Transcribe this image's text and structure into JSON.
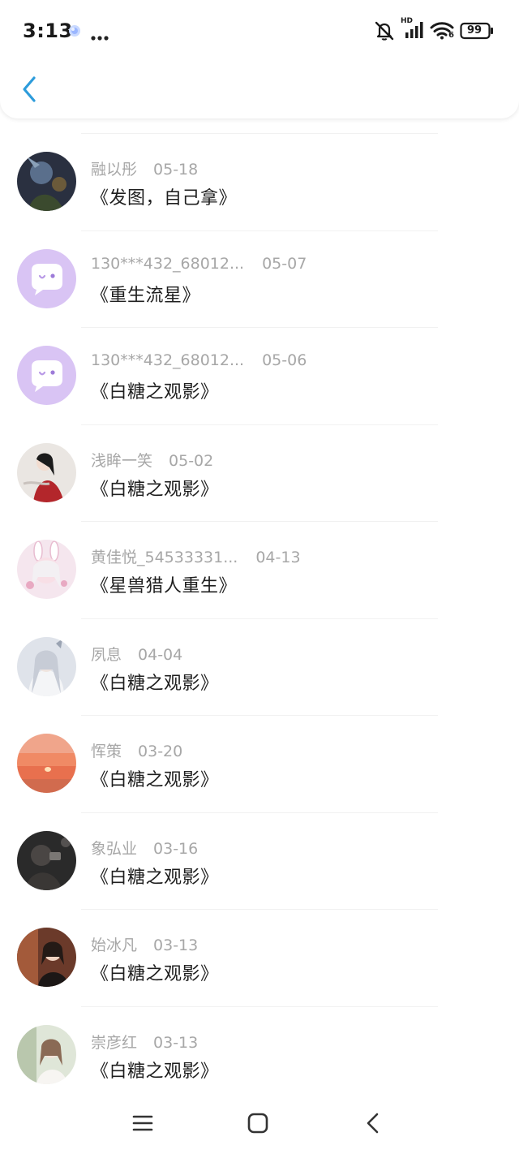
{
  "status_bar": {
    "time": "3:13",
    "hd_label": "HD",
    "wifi_badge": "6",
    "battery": "99",
    "icons": [
      "assistant-icon",
      "more-dots-icon",
      "mute-bell-icon",
      "signal-icon",
      "wifi-icon",
      "battery-icon"
    ]
  },
  "header": {
    "back_icon": "chevron-left-icon",
    "accent": "#2d9cdb"
  },
  "messages": [
    {
      "name": "融以彤",
      "date": "05-18",
      "title": "《发图，自己拿》",
      "avatar": "dark-fantasy"
    },
    {
      "name": "130***432_68012...",
      "date": "05-07",
      "title": "《重生流星》",
      "avatar": "default-bubble"
    },
    {
      "name": "130***432_68012...",
      "date": "05-06",
      "title": "《白糖之观影》",
      "avatar": "default-bubble"
    },
    {
      "name": "浅眸一笑",
      "date": "05-02",
      "title": "《白糖之观影》",
      "avatar": "red-robe"
    },
    {
      "name": "黄佳悦_54533331...",
      "date": "04-13",
      "title": "《星兽猎人重生》",
      "avatar": "pink-bunny"
    },
    {
      "name": "夙息",
      "date": "04-04",
      "title": "《白糖之观影》",
      "avatar": "white-hair"
    },
    {
      "name": "恽策",
      "date": "03-20",
      "title": "《白糖之观影》",
      "avatar": "sunset"
    },
    {
      "name": "象弘业",
      "date": "03-16",
      "title": "《白糖之观影》",
      "avatar": "dark-photo"
    },
    {
      "name": "始冰凡",
      "date": "03-13",
      "title": "《白糖之观影》",
      "avatar": "girl-dark"
    },
    {
      "name": "崇彦红",
      "date": "03-13",
      "title": "《白糖之观影》",
      "avatar": "girl-light"
    }
  ],
  "navbar": {
    "icons": [
      "menu-icon",
      "home-square-icon",
      "back-triangle-icon"
    ]
  }
}
